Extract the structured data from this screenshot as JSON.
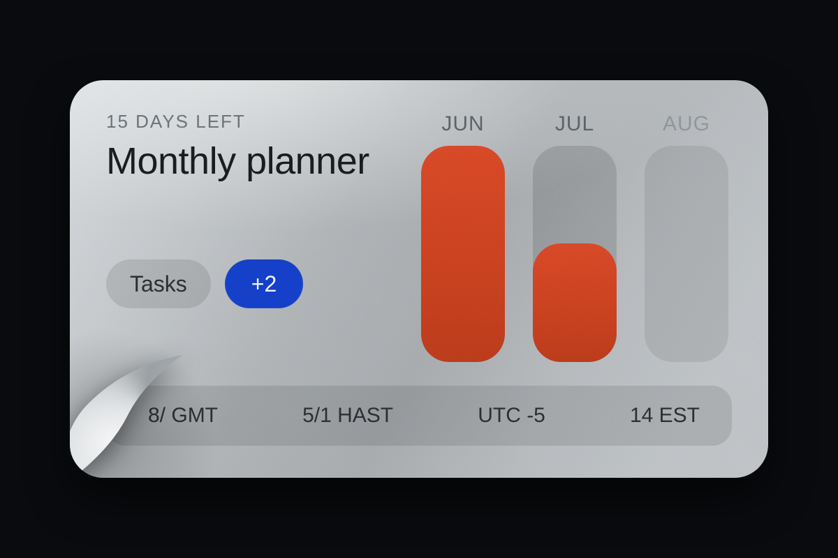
{
  "header": {
    "eyebrow": "15 DAYS LEFT",
    "title": "Monthly planner"
  },
  "chips": {
    "tasks_label": "Tasks",
    "count_label": "+2"
  },
  "months": [
    {
      "label": "JUN",
      "fill": 100
    },
    {
      "label": "JUL",
      "fill": 55
    },
    {
      "label": "AUG",
      "fill": 0
    }
  ],
  "timezones": [
    "8/ GMT",
    "5/1 HAST",
    "UTC -5",
    "14 EST"
  ],
  "colors": {
    "accent_red": "#d84a28",
    "accent_blue": "#1540c9",
    "card_bg": "#b7bbbe"
  },
  "chart_data": {
    "type": "bar",
    "categories": [
      "JUN",
      "JUL",
      "AUG"
    ],
    "values": [
      100,
      55,
      0
    ],
    "title": "Monthly planner",
    "xlabel": "",
    "ylabel": "",
    "ylim": [
      0,
      100
    ]
  }
}
